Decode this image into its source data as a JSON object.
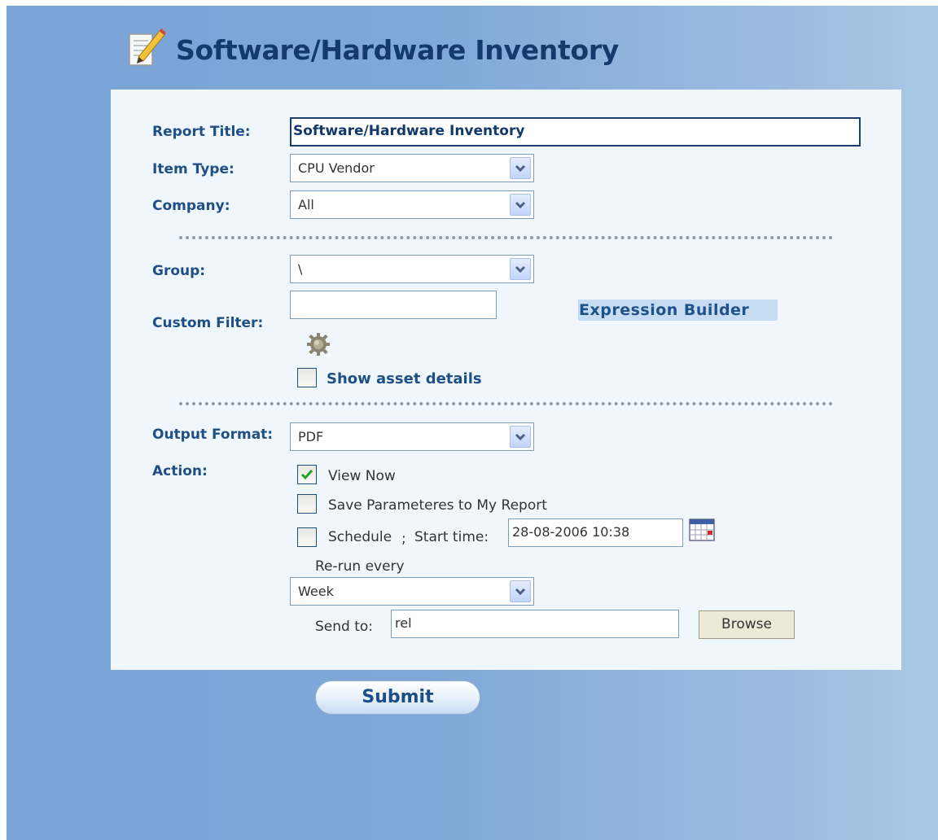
{
  "header": {
    "title": "Software/Hardware Inventory",
    "icon": "notepad-pencil-icon"
  },
  "form": {
    "report_title": {
      "label": "Report Title:",
      "value": "Software/Hardware Inventory"
    },
    "item_type": {
      "label": "Item Type:",
      "value": "CPU Vendor"
    },
    "company": {
      "label": "Company:",
      "value": "All"
    },
    "group": {
      "label": "Group:",
      "value": "\\"
    },
    "custom_filter": {
      "label": "Custom Filter:",
      "value": "",
      "expression_builder": "Expression Builder"
    },
    "show_asset_details": {
      "label": "Show asset details",
      "checked": false
    },
    "output_format": {
      "label": "Output Format:",
      "value": "PDF"
    },
    "action": {
      "label": "Action:",
      "view_now": {
        "label": "View Now",
        "checked": true
      },
      "save_params": {
        "label": "Save Parameteres to My Report",
        "checked": false
      },
      "schedule": {
        "label": "Schedule",
        "checked": false,
        "separator": ";"
      },
      "start_time": {
        "label": "Start time:",
        "value": "28-08-2006 10:38"
      },
      "rerun": {
        "label": "Re-run every",
        "value": "Week"
      },
      "send_to": {
        "label": "Send to:",
        "value": "rel"
      },
      "browse": "Browse"
    },
    "submit": "Submit"
  },
  "colors": {
    "label": "#1f4f84",
    "title": "#133a6b",
    "panel": "#eff7fc",
    "accent": "#c6dcf2"
  }
}
